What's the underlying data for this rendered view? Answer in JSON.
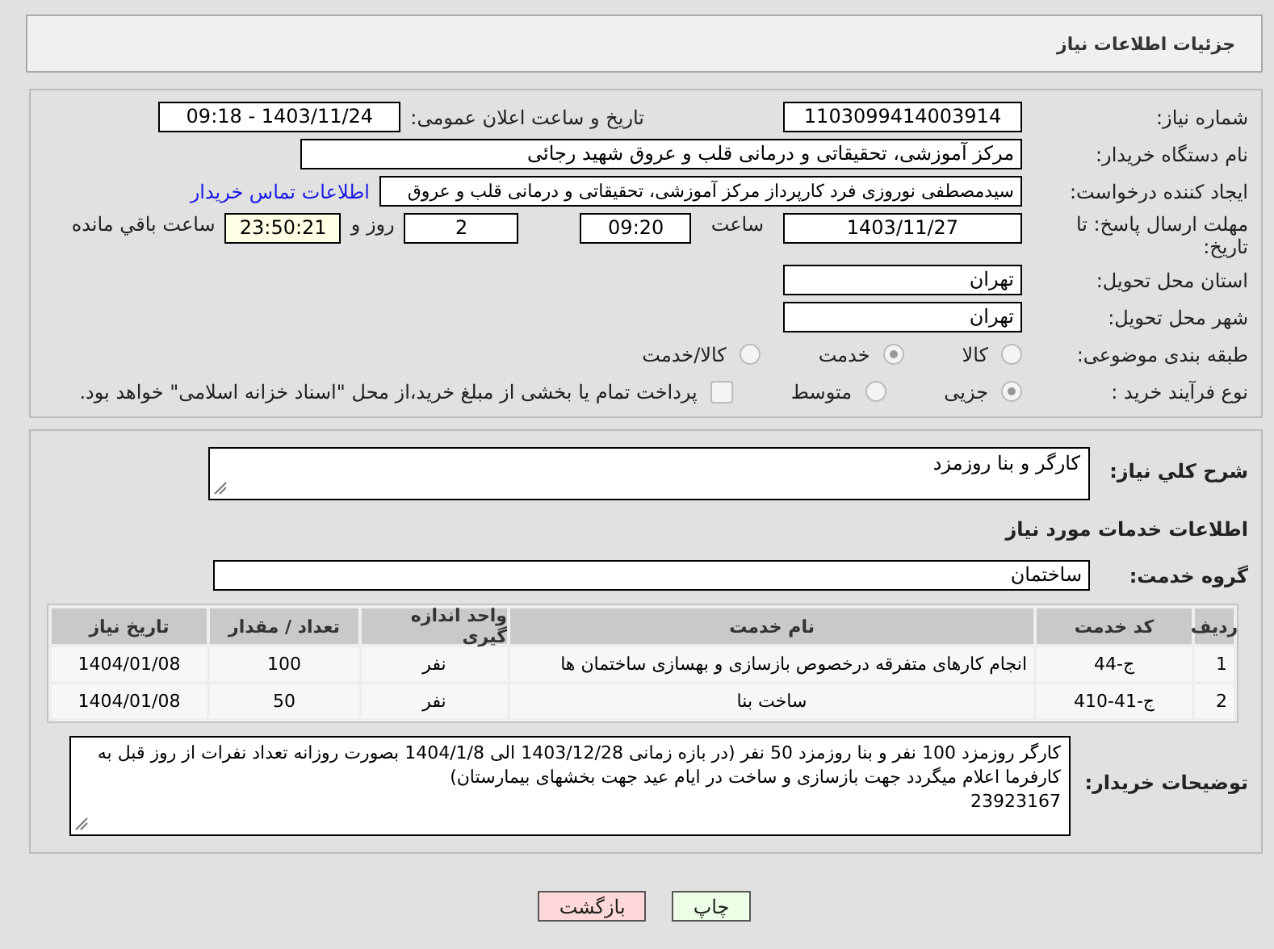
{
  "header": {
    "title": "جزئیات اطلاعات نیاز"
  },
  "need_number": {
    "label": "شماره نیاز:",
    "value": "1103099414003914"
  },
  "announce": {
    "label": "تاریخ و ساعت اعلان عمومی:",
    "value": "1403/11/24 - 09:18"
  },
  "buyer": {
    "label": "نام دستگاه خریدار:",
    "value": "مرکز آموزشی، تحقیقاتی و درمانی قلب و عروق شهید رجائی"
  },
  "creator": {
    "label": "ایجاد کننده درخواست:",
    "value": "سیدمصطفی نوروزی فرد کارپرداز مرکز آموزشی، تحقیقاتی و درمانی قلب و عروق",
    "link": "اطلاعات تماس خریدار"
  },
  "deadline": {
    "label": "مهلت ارسال پاسخ: تا تاریخ:",
    "date": "1403/11/27",
    "time_label": "ساعت",
    "time": "09:20",
    "days": "2",
    "days_label": "روز و",
    "remaining": "23:50:21",
    "remaining_label": "ساعت باقي مانده"
  },
  "province": {
    "label": "استان محل تحویل:",
    "value": "تهران"
  },
  "city": {
    "label": "شهر محل تحویل:",
    "value": "تهران"
  },
  "category": {
    "label": "طبقه بندی موضوعی:",
    "options": [
      {
        "label": "کالا",
        "selected": false
      },
      {
        "label": "خدمت",
        "selected": true
      },
      {
        "label": "کالا/خدمت",
        "selected": false
      }
    ]
  },
  "process": {
    "label": "نوع فرآیند خرید :",
    "options": [
      {
        "label": "جزیی",
        "selected": true
      },
      {
        "label": "متوسط",
        "selected": false
      }
    ],
    "payment": {
      "label": "پرداخت تمام یا بخشی از مبلغ خرید،از محل \"اسناد خزانه اسلامی\" خواهد بود.",
      "checked": false
    }
  },
  "summary": {
    "label": "شرح کلي نیاز:",
    "value": "کارگر و بنا روزمزد"
  },
  "services_heading": "اطلاعات خدمات مورد نیاز",
  "service_group": {
    "label": "گروه خدمت:",
    "value": "ساختمان"
  },
  "table": {
    "columns": [
      "ردیف",
      "کد خدمت",
      "نام خدمت",
      "واحد اندازه گیری",
      "تعداد / مقدار",
      "تاریخ نیاز"
    ],
    "rows": [
      [
        "1",
        "ج-44",
        "انجام کارهای متفرقه درخصوص بازسازی و بهسازی ساختمان ها",
        "نفر",
        "100",
        "1404/01/08"
      ],
      [
        "2",
        "ج-41-410",
        "ساخت بنا",
        "نفر",
        "50",
        "1404/01/08"
      ]
    ]
  },
  "buyer_notes": {
    "label": "توضیحات خریدار:",
    "lines": [
      "کارگر روزمزد 100 نفر و بنا روزمزد 50 نفر (در بازه زمانی 1403/12/28 الی 1404/1/8 بصورت روزانه تعداد نفرات از روز قبل به کارفرما اعلام میگردد جهت بازسازی و ساخت در ایام عید جهت بخشهای بیمارستان)",
      "23923167"
    ]
  },
  "buttons": [
    {
      "label": "چاپ",
      "kind": "print"
    },
    {
      "label": "بازگشت",
      "kind": "back"
    }
  ]
}
